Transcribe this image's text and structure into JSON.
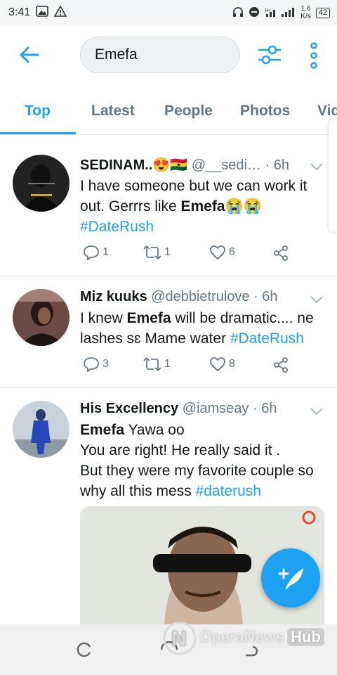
{
  "status_bar": {
    "time": "3:41",
    "net_speed": "1.6\nK/s",
    "battery": "42",
    "icons": [
      "gallery-icon",
      "warning-icon",
      "headset-icon",
      "dnd-icon",
      "signal-icon"
    ]
  },
  "search": {
    "value": "Emefa"
  },
  "tabs": [
    {
      "label": "Top",
      "active": true
    },
    {
      "label": "Latest",
      "active": false
    },
    {
      "label": "People",
      "active": false
    },
    {
      "label": "Photos",
      "active": false
    },
    {
      "label": "Vid",
      "active": false
    }
  ],
  "tweets": [
    {
      "name": "SEDINAM..😍🇬🇭",
      "handle": "@__sedi…",
      "time": "· 6h",
      "text_before": "I have someone but we can work it out. Gerrrs like ",
      "highlight": "Emefa",
      "text_after": "😭😭",
      "hashtag": "#DateRush",
      "replies": "1",
      "retweets": "1",
      "likes": "6"
    },
    {
      "name": "Miz kuuks",
      "handle": "@debbietrulove",
      "time": "· 6h",
      "text_before": "I knew ",
      "highlight": "Emefa",
      "text_after": " will be dramatic.... ne lashes sɛ Mame water ",
      "hashtag": "#DateRush",
      "replies": "3",
      "retweets": "1",
      "likes": "8"
    },
    {
      "name": "His Excellency",
      "handle": "@iamseay",
      "time": "· 6h",
      "highlight": "Emefa",
      "line1_rest": " Yawa oo",
      "line2": "You are right! He really said it .",
      "line3": "But they were my favorite couple so why all this mess ",
      "hashtag": "#daterush"
    }
  ],
  "watermark": {
    "left": "Opera",
    "mid": "News",
    "hub": "Hub"
  },
  "colors": {
    "accent": "#1da1f2",
    "muted": "#657786",
    "text": "#14171a"
  }
}
